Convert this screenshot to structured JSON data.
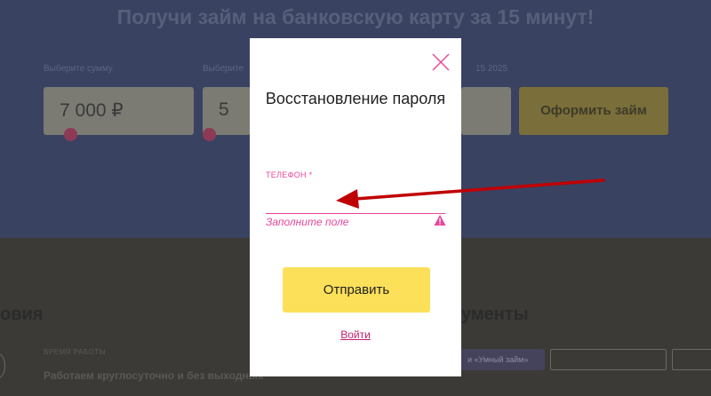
{
  "background": {
    "hero_title": "Получи займ на банковскую карту за 15 минут!",
    "amount_label": "Выберите сумму",
    "term_label": "Выберите",
    "date_fragment": "15 2025",
    "amount_value": "7 000 ₽",
    "term_value": "5",
    "apply_button": "Оформить займ",
    "left_heading": "овия",
    "right_heading": "ументы",
    "work_time_label": "ВРЕМЯ РАБОТЫ",
    "work_time_text": "Работаем круглосуточно и без выходных",
    "chips": [
      "и «Умный займ»",
      "",
      ""
    ]
  },
  "modal": {
    "title": "Восстановление пароля",
    "phone_label": "ТЕЛЕФОН *",
    "phone_value": "",
    "error_text": "Заполните поле",
    "submit_label": "Отправить",
    "login_link": "Войти"
  },
  "colors": {
    "accent_pink": "#e8459a",
    "button_yellow": "#fde05a",
    "arrow_red": "#c00000"
  },
  "icons": {
    "close": "close-icon",
    "warning": "warning-icon"
  }
}
